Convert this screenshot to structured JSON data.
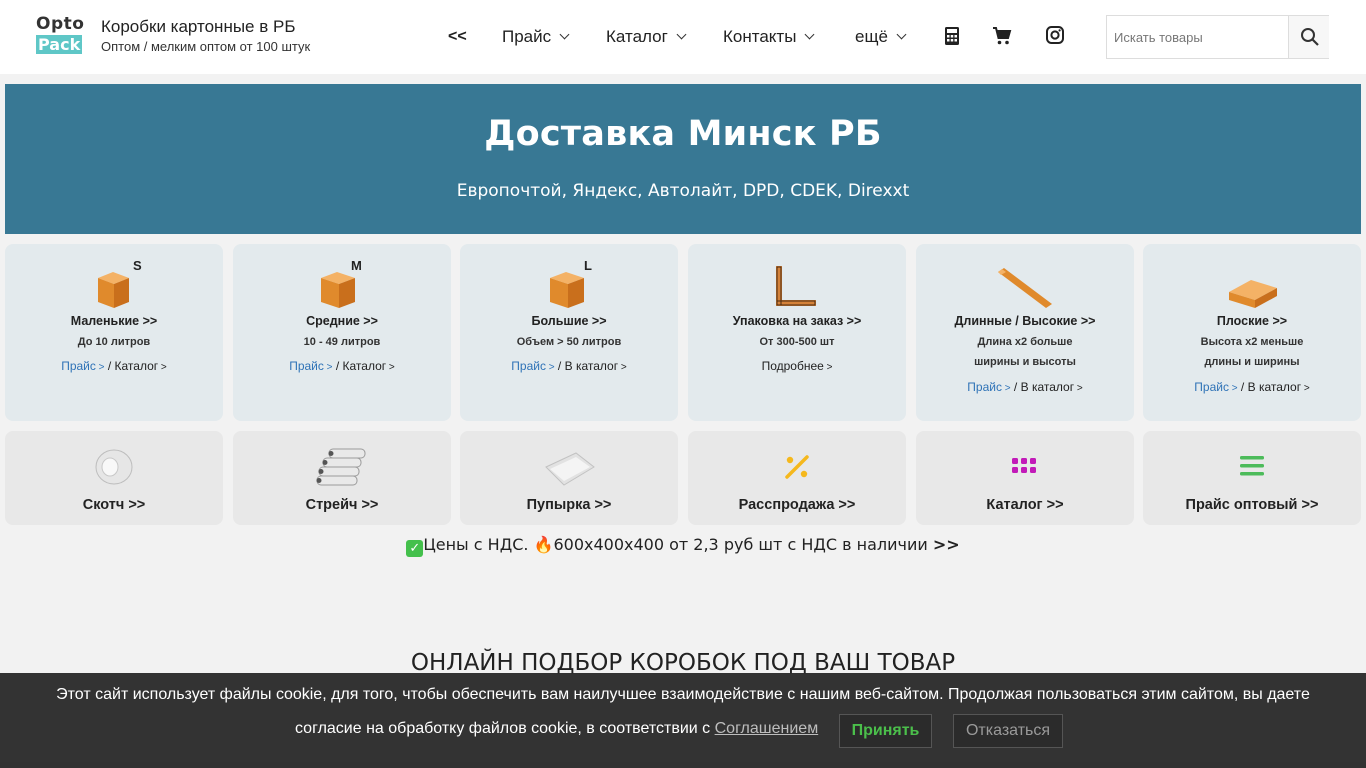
{
  "header": {
    "logo_top": "Opto",
    "logo_bottom": "Pack",
    "site_title": "Коробки картонные в РБ",
    "site_subtitle": "Оптом / мелким оптом от 100 штук",
    "nav": {
      "back": "<<",
      "price": "Прайс",
      "catalog": "Каталог",
      "contacts": "Контакты",
      "more": "ещё"
    },
    "icons": [
      "calculator-icon",
      "cart-icon",
      "instagram-icon",
      "search-icon"
    ],
    "search_placeholder": "Искать товары"
  },
  "banner": {
    "title": "Доставка Минск РБ",
    "subtitle": "Европочтой, Яндекс, Автолайт, DPD, CDEK, Direxxt",
    "bg_color": "#387894"
  },
  "categories": [
    {
      "size": "S",
      "title": "Маленькие >>",
      "desc": [
        "До 10 литров"
      ],
      "link_price": "Прайс",
      "link_catalog": "Каталог"
    },
    {
      "size": "M",
      "title": "Средние >>",
      "desc": [
        "10 - 49 литров"
      ],
      "link_price": "Прайс",
      "link_catalog": "Каталог"
    },
    {
      "size": "L",
      "title": "Большие >>",
      "desc": [
        "Объем > 50 литров"
      ],
      "link_price": "Прайс",
      "link_catalog": "В каталог"
    },
    {
      "size": "",
      "title": "Упаковка на заказ >>",
      "desc": [
        "От 300-500 шт"
      ],
      "link_more": "Подробнее"
    },
    {
      "size": "",
      "title": "Длинные / Высокие >>",
      "desc": [
        "Длина х2 больше",
        "ширины и высоты"
      ],
      "link_price": "Прайс",
      "link_catalog": "В каталог"
    },
    {
      "size": "",
      "title": "Плоские >>",
      "desc": [
        "Высота х2 меньше",
        "длины и ширины"
      ],
      "link_price": "Прайс",
      "link_catalog": "В каталог"
    }
  ],
  "products": [
    {
      "title": "Скотч >>",
      "icon": "tape-icon"
    },
    {
      "title": "Стрейч >>",
      "icon": "stretch-film-icon"
    },
    {
      "title": "Пупырка >>",
      "icon": "bubble-wrap-icon"
    },
    {
      "title": "Расспродажа >>",
      "icon": "percent-icon"
    },
    {
      "title": "Каталог >>",
      "icon": "grid-icon"
    },
    {
      "title": "Прайс оптовый >>",
      "icon": "list-icon"
    }
  ],
  "promo": {
    "part1": "Цены с НДС. ",
    "part2": "600x400x400 от 2,3 руб шт с НДС в наличии ",
    "link": ">>"
  },
  "section_title": "ОНЛАЙН ПОДБОР КОРОБОК ПОД ВАШ ТОВАР",
  "cookie": {
    "line1": "Этот сайт использует файлы cookie, для того, чтобы обеспечить вам наилучшее взаимодействие с нашим веб-сайтом. Продолжая пользоваться этим сайтом, вы даете",
    "line2": "согласие на обработку файлов cookie, в соответствии с ",
    "link": "Соглашением",
    "accept": "Принять",
    "decline": "Отказаться"
  }
}
